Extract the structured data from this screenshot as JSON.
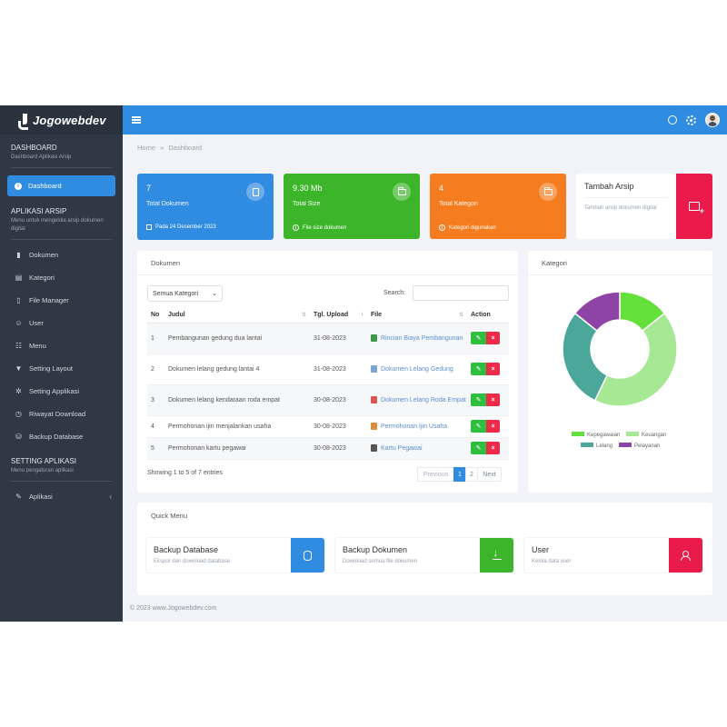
{
  "brand": {
    "name": "Jogowebdev"
  },
  "sidebar": {
    "dashboard_section": {
      "title": "DASHBOARD",
      "subtitle": "Dashboard Aplikasi Arsip"
    },
    "active_item": {
      "label": "Dashboard",
      "icon": "info-icon"
    },
    "arsip_section": {
      "title": "APLIKASI ARSIP",
      "subtitle": "Menu untuk mengelola arsip dokumen digital"
    },
    "items": [
      {
        "label": "Dokumen",
        "icon": "book-icon"
      },
      {
        "label": "Kategori",
        "icon": "list-icon"
      },
      {
        "label": "File Manager",
        "icon": "file-icon"
      },
      {
        "label": "User",
        "icon": "user-icon"
      },
      {
        "label": "Menu",
        "icon": "menu-icon"
      },
      {
        "label": "Setting Layout",
        "icon": "brush-icon"
      },
      {
        "label": "Setting Applikasi",
        "icon": "gear-icon"
      },
      {
        "label": "Riwayat Download",
        "icon": "clock-icon"
      },
      {
        "label": "Backup Database",
        "icon": "database-icon"
      }
    ],
    "setting_section": {
      "title": "SETTING APLIKASI",
      "subtitle": "Menu pengaturan aplikasi"
    },
    "aplikasi_item": {
      "label": "Aplikasi",
      "icon": "wrench-icon"
    }
  },
  "breadcrumb": {
    "home": "Home",
    "sep": "»",
    "current": "Dashboard"
  },
  "stats": [
    {
      "value": "7",
      "label": "Total Dokumen",
      "foot": "Pada 24 Desember 2023",
      "color": "#2f8ce0"
    },
    {
      "value": "9.30 Mb",
      "label": "Total Size",
      "foot": "File size dokumen",
      "color": "#3db52b"
    },
    {
      "value": "4",
      "label": "Total Kategori",
      "foot": "Kategori digunakan",
      "color": "#f57c1f"
    }
  ],
  "tambah_arsip": {
    "title": "Tambah Arsip",
    "desc": "Tambah arsip dokumen digital",
    "color": "#ea1a4a"
  },
  "documents": {
    "title": "Dokumen",
    "filter": "Semua Kategori",
    "search_label": "Search:",
    "columns": [
      "No",
      "Judul",
      "Tgl. Upload",
      "File",
      "Action"
    ],
    "rows": [
      {
        "no": "1",
        "judul": "Pembangunan gedung dua lantai",
        "tgl": "31-08-2023",
        "file": "Rincian Biaya Pembangunan",
        "ftype": "#3a9a4a"
      },
      {
        "no": "2",
        "judul": "Dokumen lelang gedung lantai 4",
        "tgl": "31-08-2023",
        "file": "Dokumen Lelang Gedung",
        "ftype": "#7aa6d6"
      },
      {
        "no": "3",
        "judul": "Dokumen lelang kendaraan roda empat",
        "tgl": "30-08-2023",
        "file": "Dokumen Lelang Roda Empat",
        "ftype": "#d9534f"
      },
      {
        "no": "4",
        "judul": "Permohonan ijin menjalankan usaha",
        "tgl": "30-08-2023",
        "file": "Permohonan Ijin Usaha",
        "ftype": "#e08a3c"
      },
      {
        "no": "5",
        "judul": "Permohonan kartu pegawai",
        "tgl": "30-08-2023",
        "file": "Kartu Pegawai",
        "ftype": "#555555"
      }
    ],
    "showing": "Showing 1 to 5 of 7 entries",
    "pager": {
      "prev": "Previous",
      "p1": "1",
      "p2": "2",
      "next": "Next"
    }
  },
  "kategori": {
    "title": "Kategori",
    "chart_data": {
      "type": "pie",
      "categories": [
        "Kepegawaian",
        "Keuangan",
        "Lelang",
        "Pelayanan"
      ],
      "values": [
        1,
        3,
        2,
        1
      ],
      "colors": [
        "#63e03a",
        "#a7e895",
        "#4aa79a",
        "#8e43a6"
      ],
      "legend_position": "bottom"
    }
  },
  "quick_menu": {
    "title": "Quick Menu",
    "items": [
      {
        "title": "Backup Database",
        "desc": "Ekspor dan download database",
        "color": "#2f8ce0"
      },
      {
        "title": "Backup Dokumen",
        "desc": "Download semua file dokumen",
        "color": "#3db52b"
      },
      {
        "title": "User",
        "desc": "Kelola data user",
        "color": "#ea1a4a"
      }
    ]
  },
  "footer": {
    "text": "© 2023 www.Jogowebdev.com"
  }
}
